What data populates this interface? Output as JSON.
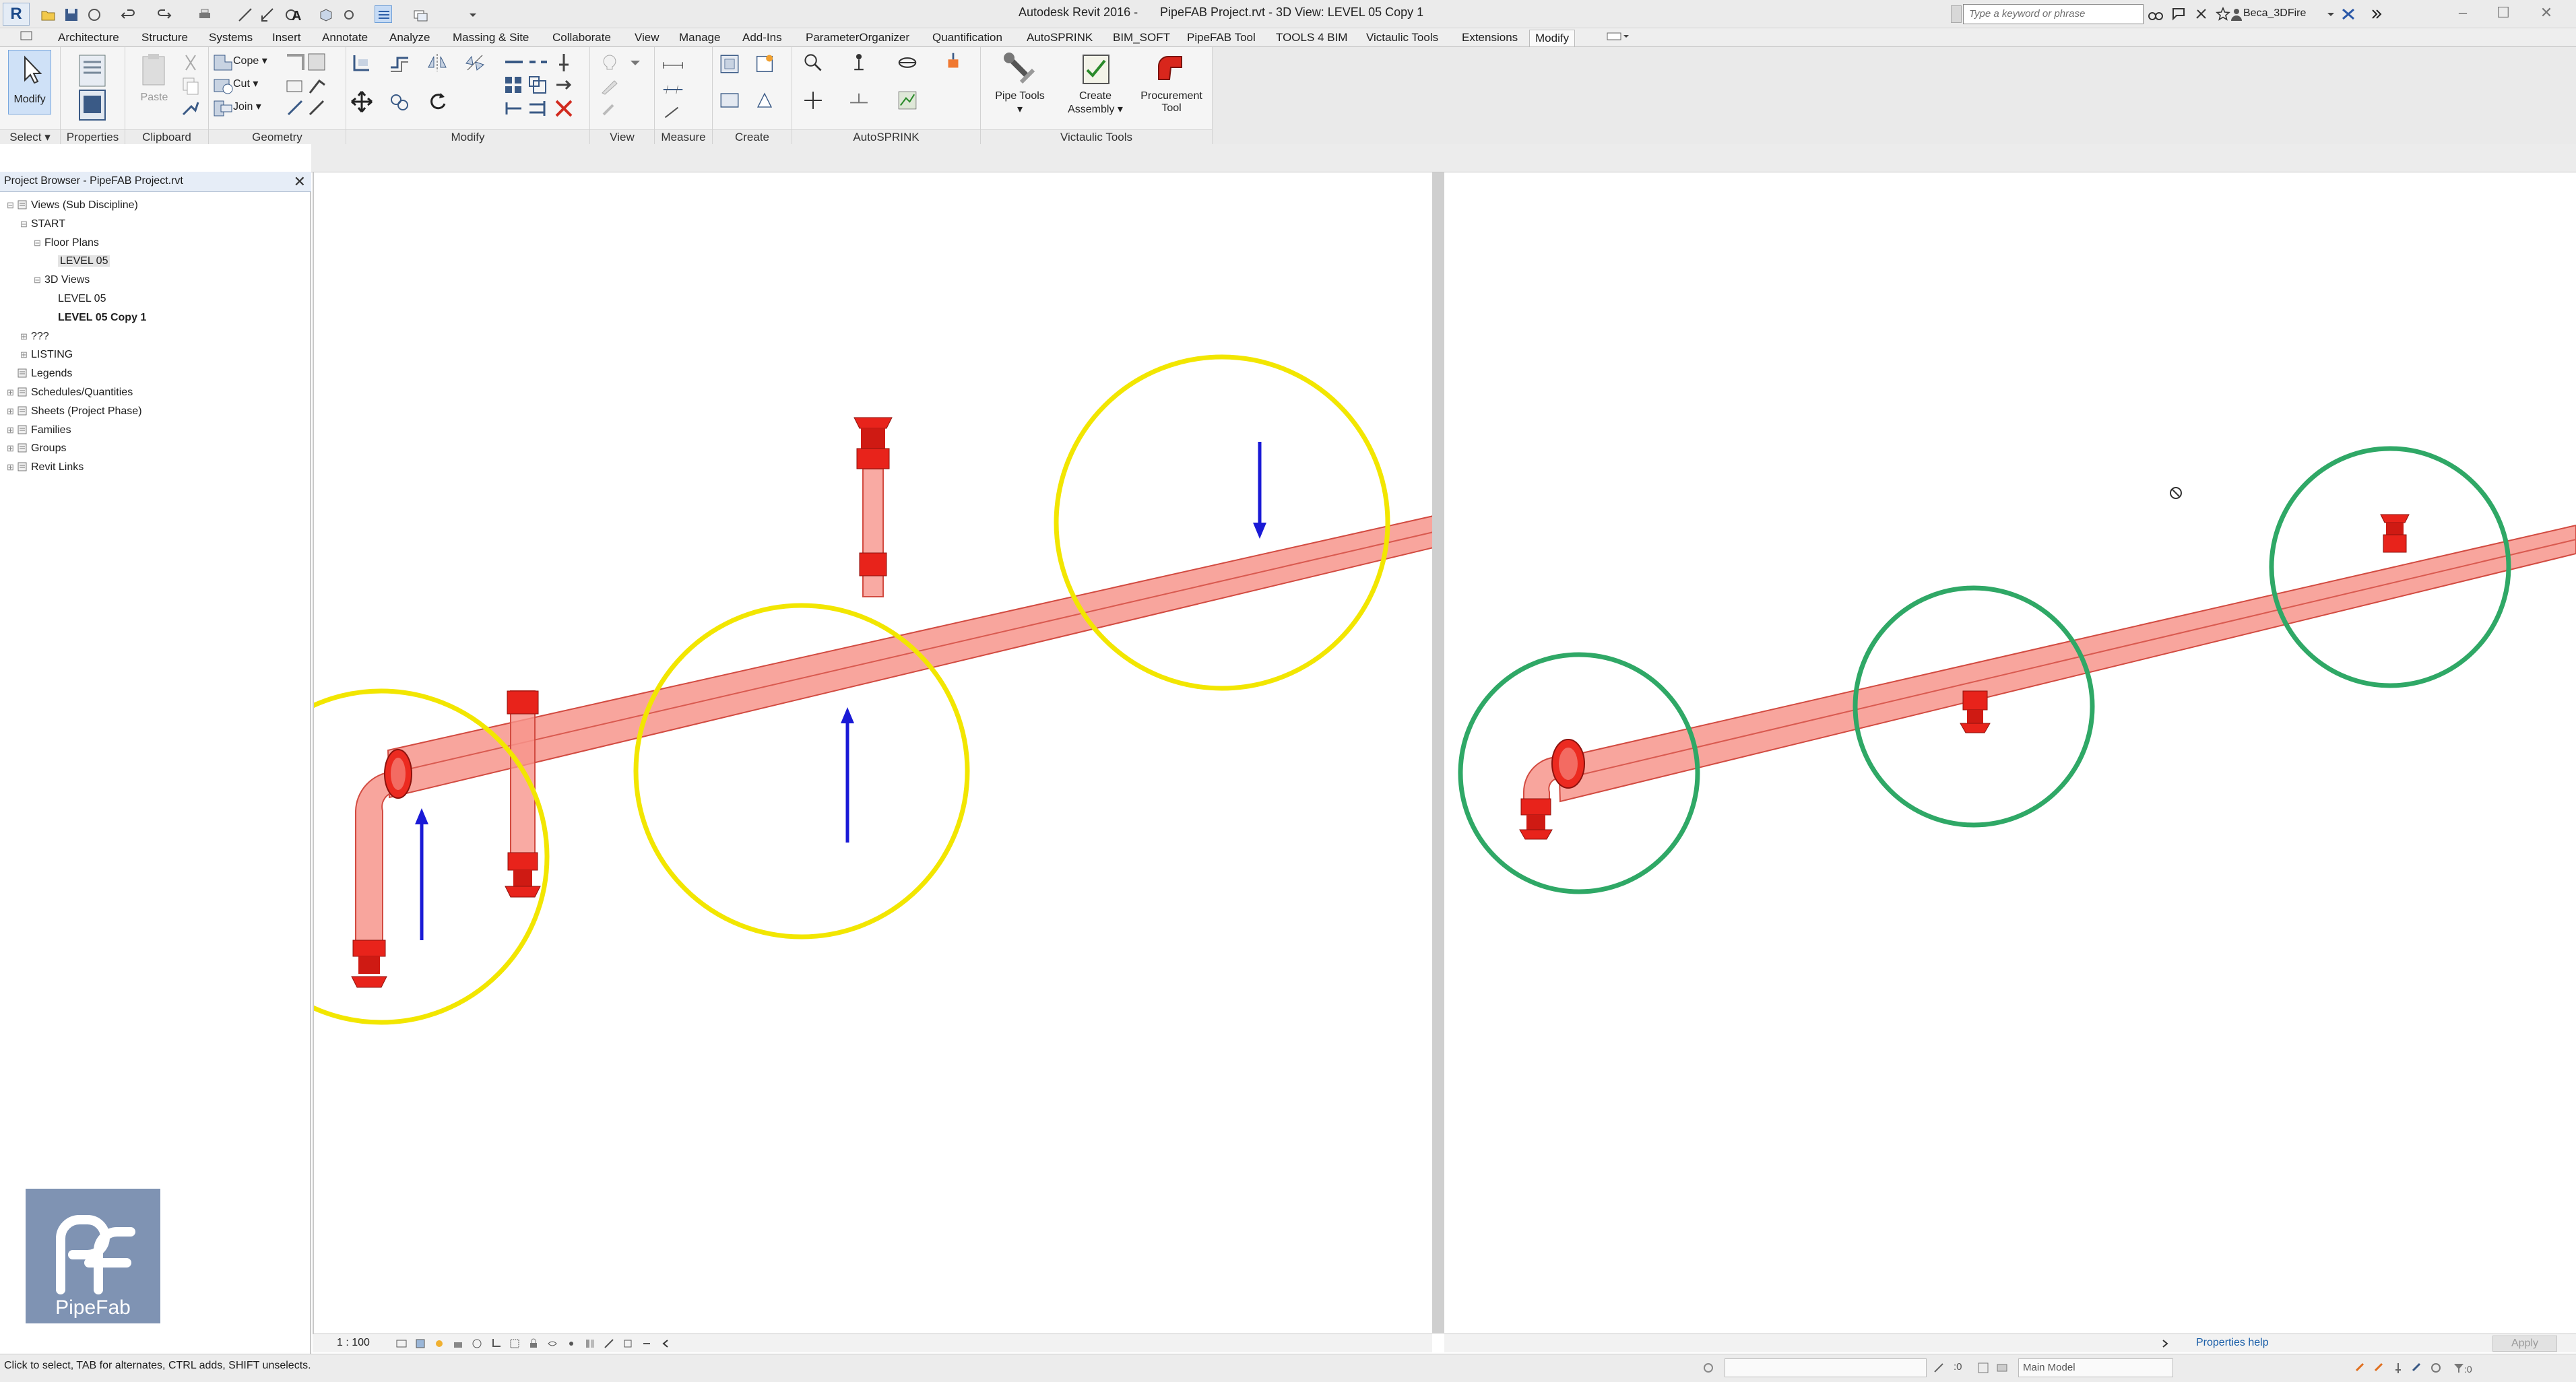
{
  "app": {
    "title": "Autodesk Revit 2016 -",
    "file_view": "PipeFAB Project.rvt - 3D View: LEVEL 05 Copy 1",
    "logo_letter": "R"
  },
  "search": {
    "placeholder": "Type a keyword or phrase"
  },
  "user": {
    "name": "Beca_3DFire"
  },
  "tabs": [
    "Architecture",
    "Structure",
    "Systems",
    "Insert",
    "Annotate",
    "Analyze",
    "Massing & Site",
    "Collaborate",
    "View",
    "Manage",
    "Add-Ins",
    "ParameterOrganizer",
    "Quantification",
    "AutoSPRINK",
    "BIM_SOFT",
    "PipeFAB Tool",
    "TOOLS 4 BIM",
    "Victaulic Tools",
    "Extensions",
    "Modify"
  ],
  "ribbon": {
    "select_label": "Modify",
    "select_panel": "Select",
    "properties_panel": "Properties",
    "paste_label": "Paste",
    "clipboard_panel": "Clipboard",
    "cope_label": "Cope",
    "cut_label": "Cut",
    "join_label": "Join",
    "geometry_panel": "Geometry",
    "modify_panel": "Modify",
    "view_panel": "View",
    "measure_panel": "Measure",
    "create_panel": "Create",
    "autosprink_panel": "AutoSPRINK",
    "pipe_tools_label": "Pipe Tools",
    "create_assembly_label1": "Create",
    "create_assembly_label2": "Assembly",
    "procurement_label1": "Procurement",
    "procurement_label2": "Tool",
    "victaulic_panel": "Victaulic Tools"
  },
  "project_browser": {
    "title": "Project Browser - PipeFAB Project.rvt",
    "items": [
      {
        "label": "Views (Sub Discipline)",
        "level": 0,
        "exp": "⊟"
      },
      {
        "label": "START",
        "level": 1,
        "exp": "⊟"
      },
      {
        "label": "Floor Plans",
        "level": 2,
        "exp": "⊟"
      },
      {
        "label": "LEVEL 05",
        "level": 3,
        "exp": "",
        "selected": true
      },
      {
        "label": "3D Views",
        "level": 2,
        "exp": "⊟"
      },
      {
        "label": "LEVEL 05",
        "level": 3,
        "exp": ""
      },
      {
        "label": "LEVEL 05 Copy 1",
        "level": 3,
        "exp": "",
        "bold": true
      },
      {
        "label": "???",
        "level": 1,
        "exp": "⊞"
      },
      {
        "label": "LISTING",
        "level": 1,
        "exp": "⊞"
      },
      {
        "label": "Legends",
        "level": 0,
        "exp": ""
      },
      {
        "label": "Schedules/Quantities",
        "level": 0,
        "exp": "⊞"
      },
      {
        "label": "Sheets (Project Phase)",
        "level": 0,
        "exp": "⊞"
      },
      {
        "label": "Families",
        "level": 0,
        "exp": "⊞"
      },
      {
        "label": "Groups",
        "level": 0,
        "exp": "⊞"
      },
      {
        "label": "Revit Links",
        "level": 0,
        "exp": "⊞"
      }
    ]
  },
  "logo": {
    "text": "PipeFab"
  },
  "view_left": {
    "scale": "1 : 100"
  },
  "view_right": {
    "properties_help": "Properties help",
    "apply": "Apply"
  },
  "status": {
    "message": "Click to select, TAB for alternates, CTRL adds, SHIFT unselects.",
    "selection_count": ":0",
    "model": "Main Model",
    "filter_count": ":0"
  },
  "colors": {
    "highlight_yellow": "#f2e600",
    "highlight_green": "#2fa866",
    "pipe_red": "#f5867e",
    "sprinkler_red": "#e8231b",
    "arrow_blue": "#1a1ad6"
  }
}
